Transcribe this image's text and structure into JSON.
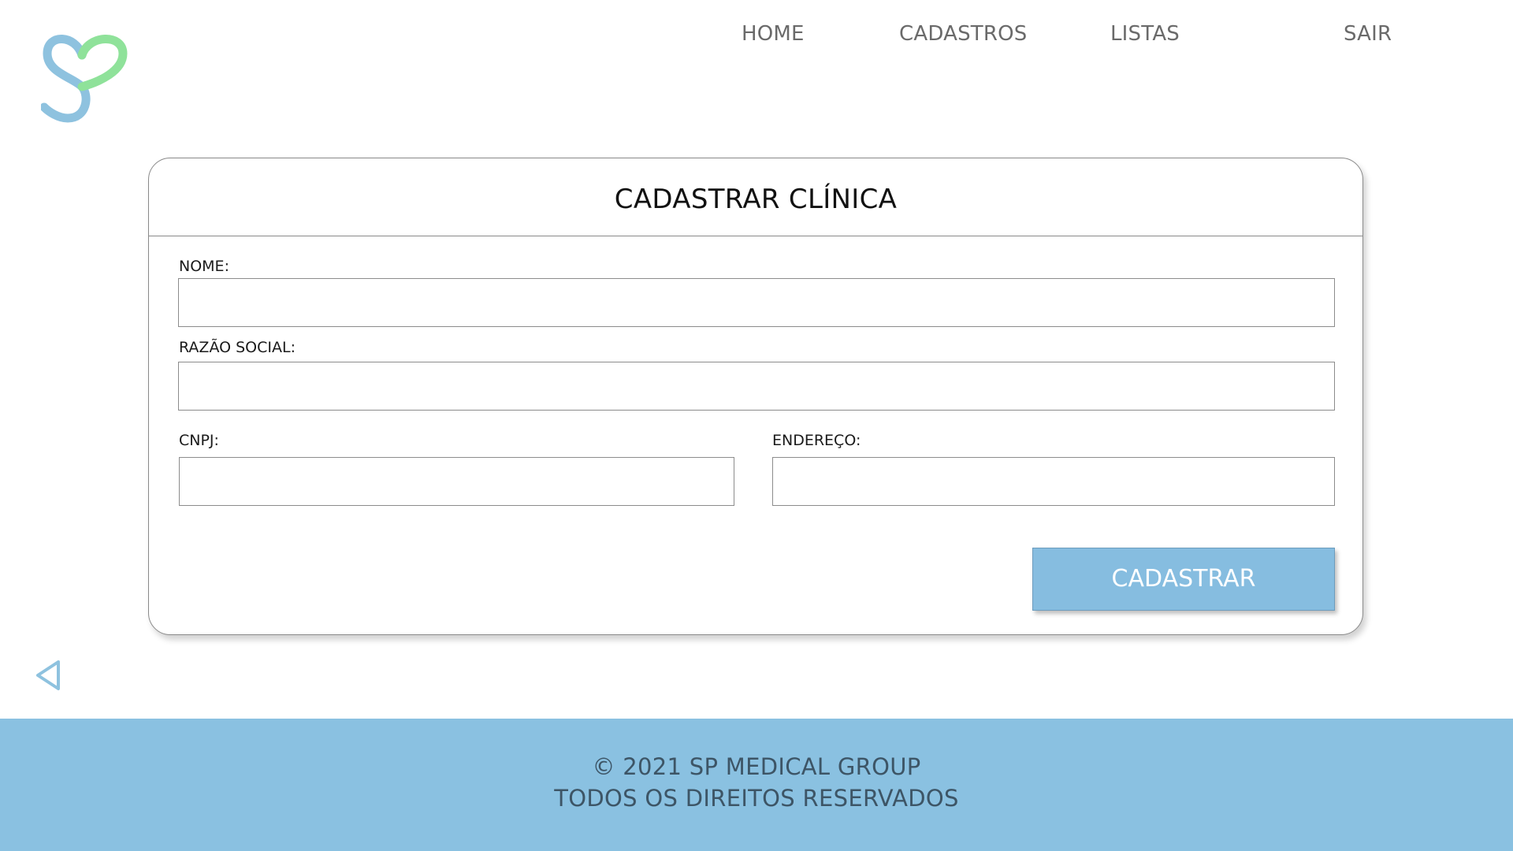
{
  "header": {
    "logo_icon": "sp-heart-logo-icon",
    "nav": {
      "home": "HOME",
      "cadastros": "CADASTROS",
      "listas": "LISTAS",
      "sair": "SAIR"
    }
  },
  "form": {
    "title": "CADASTRAR CLÍNICA",
    "fields": {
      "nome": {
        "label": "NOME:",
        "value": ""
      },
      "razao_social": {
        "label": "RAZÃO SOCIAL:",
        "value": ""
      },
      "cnpj": {
        "label": "CNPJ:",
        "value": ""
      },
      "endereco": {
        "label": "ENDEREÇO:",
        "value": ""
      }
    },
    "submit_label": "CADASTRAR"
  },
  "back_icon": "back-triangle-icon",
  "footer": {
    "copyright": "© 2021 SP MEDICAL GROUP",
    "rights": "TODOS OS DIREITOS RESERVADOS"
  },
  "colors": {
    "accent_blue": "#86bde0",
    "footer_blue": "#8ac1e1",
    "logo_blue": "#8ec2df",
    "logo_green": "#8fe29a",
    "nav_text": "#6a6a6a"
  }
}
